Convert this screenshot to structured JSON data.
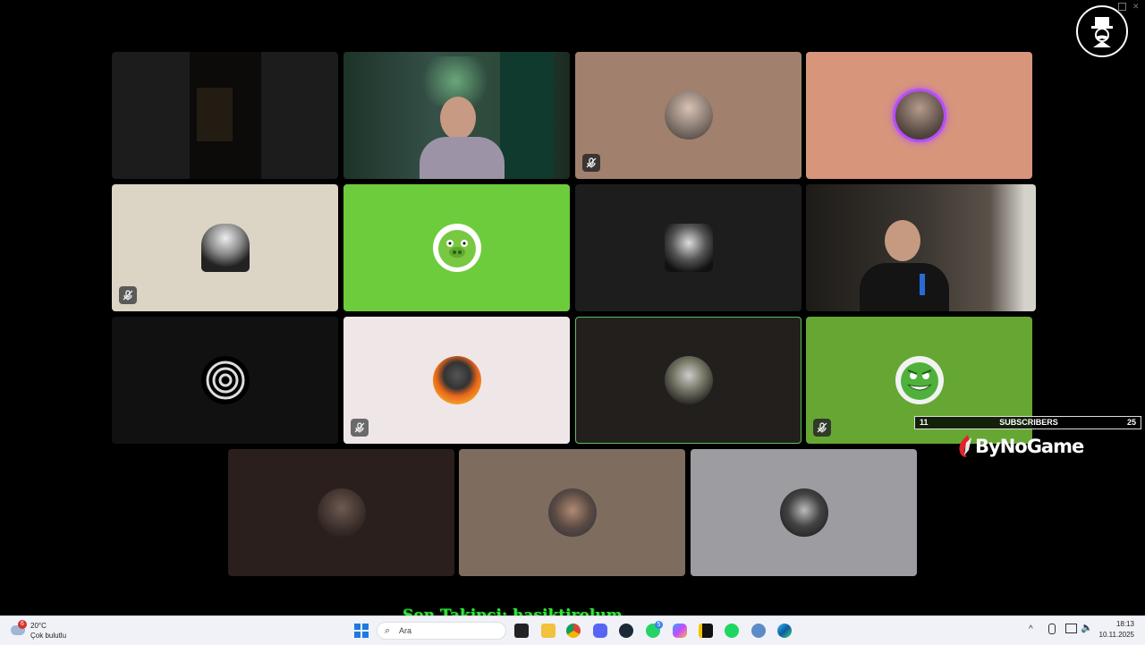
{
  "corner_logo": "top-hat-mustache-logo",
  "tiles": [
    {
      "name": "tile-1",
      "type": "video",
      "bg": "#1c1c1c",
      "muted": false
    },
    {
      "name": "tile-2",
      "type": "video",
      "bg": "#2a3b34",
      "muted": false
    },
    {
      "name": "tile-3",
      "type": "avatar",
      "bg": "#a1816d",
      "muted": true
    },
    {
      "name": "tile-4",
      "type": "avatar",
      "bg": "#d7957c",
      "muted": false,
      "speaking": true
    },
    {
      "name": "tile-5",
      "type": "avatar",
      "bg": "#dcd5c5",
      "muted": true
    },
    {
      "name": "tile-6",
      "type": "avatar",
      "bg": "#6dcc3b",
      "muted": false
    },
    {
      "name": "tile-7",
      "type": "avatar",
      "bg": "#1d1d1d",
      "muted": false
    },
    {
      "name": "tile-8",
      "type": "video",
      "bg": "#2d2a26",
      "muted": false
    },
    {
      "name": "tile-9",
      "type": "avatar",
      "bg": "#111111",
      "muted": false
    },
    {
      "name": "tile-10",
      "type": "avatar",
      "bg": "#efe7e7",
      "muted": true
    },
    {
      "name": "tile-11",
      "type": "avatar",
      "bg": "#231f1d",
      "muted": false,
      "active_border": true
    },
    {
      "name": "tile-12",
      "type": "avatar",
      "bg": "#66a734",
      "muted": true
    },
    {
      "name": "tile-13",
      "type": "avatar",
      "bg": "#2a1f1c",
      "muted": false
    },
    {
      "name": "tile-14",
      "type": "avatar",
      "bg": "#7e6d5e",
      "muted": false
    },
    {
      "name": "tile-15",
      "type": "avatar",
      "bg": "#9d9ca1",
      "muted": false
    }
  ],
  "overlay": {
    "subscribers_label": "SUBSCRIBERS",
    "subscribers_current": "11",
    "subscribers_goal": "25",
    "brand": "ByNoGame",
    "last_follower": "Son Takipçi: hasiktirolum"
  },
  "taskbar": {
    "weather_badge": "6",
    "weather_temp": "20°C",
    "weather_desc": "Çok bulutlu",
    "search_placeholder": "Ara",
    "discord_badge": "5",
    "time": "18:13",
    "date": "10.11.2025"
  },
  "colors": {
    "accent_green": "#34e23a",
    "speaking_ring": "#b64dff",
    "active_border": "#5fbf5f"
  }
}
